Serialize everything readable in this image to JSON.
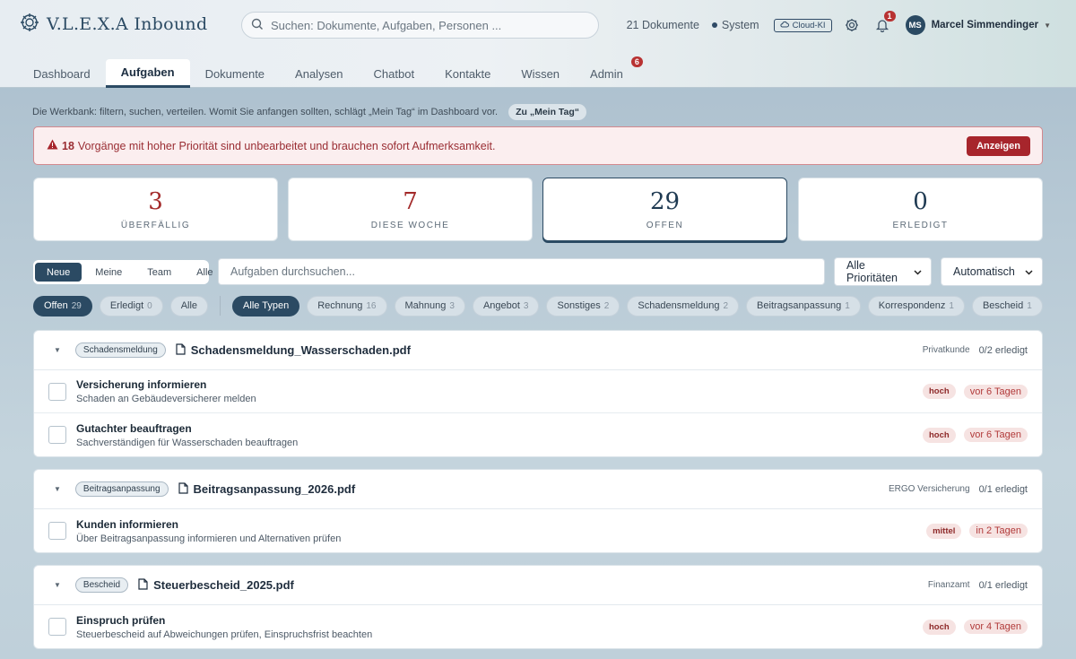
{
  "app": {
    "title": "V.L.E.X.A Inbound"
  },
  "search": {
    "placeholder": "Suchen: Dokumente, Aufgaben, Personen ..."
  },
  "status": {
    "doc_count": "21 Dokumente",
    "system": "System",
    "cloud": "Cloud-KI",
    "notif_count": "1"
  },
  "user": {
    "initials": "MS",
    "name": "Marcel Simmendinger"
  },
  "nav": {
    "tabs": [
      {
        "label": "Dashboard"
      },
      {
        "label": "Aufgaben"
      },
      {
        "label": "Dokumente"
      },
      {
        "label": "Analysen"
      },
      {
        "label": "Chatbot"
      },
      {
        "label": "Kontakte"
      },
      {
        "label": "Wissen"
      },
      {
        "label": "Admin",
        "badge": "6"
      }
    ]
  },
  "intro": {
    "text": "Die Werkbank: filtern, suchen, verteilen. Womit Sie anfangen sollten, schlägt „Mein Tag“ im Dashboard vor.",
    "link": "Zu „Mein Tag“"
  },
  "alert": {
    "count": "18",
    "text": "Vorgänge mit hoher Priorität sind unbearbeitet und brauchen sofort Aufmerksamkeit.",
    "button": "Anzeigen"
  },
  "stats": [
    {
      "value": "3",
      "label": "Überfällig",
      "color": "#a32a2a"
    },
    {
      "value": "7",
      "label": "Diese Woche",
      "color": "#a32a2a"
    },
    {
      "value": "29",
      "label": "Offen",
      "color": "#1f3a52"
    },
    {
      "value": "0",
      "label": "Erledigt",
      "color": "#1f3a52"
    }
  ],
  "filters": {
    "scope": [
      "Neue",
      "Meine",
      "Team",
      "Alle"
    ],
    "task_search_placeholder": "Aufgaben durchsuchen...",
    "priority_select": "Alle Prioritäten",
    "sort_select": "Automatisch",
    "status_pills": [
      {
        "label": "Offen",
        "count": "29"
      },
      {
        "label": "Erledigt",
        "count": "0"
      },
      {
        "label": "Alle",
        "count": ""
      }
    ],
    "type_pills": [
      {
        "label": "Alle Typen",
        "count": ""
      },
      {
        "label": "Rechnung",
        "count": "16"
      },
      {
        "label": "Mahnung",
        "count": "3"
      },
      {
        "label": "Angebot",
        "count": "3"
      },
      {
        "label": "Sonstiges",
        "count": "2"
      },
      {
        "label": "Schadensmeldung",
        "count": "2"
      },
      {
        "label": "Beitragsanpassung",
        "count": "1"
      },
      {
        "label": "Korrespondenz",
        "count": "1"
      },
      {
        "label": "Bescheid",
        "count": "1"
      }
    ]
  },
  "groups": [
    {
      "tag": "Schadensmeldung",
      "file": "Schadensmeldung_Wasserschaden.pdf",
      "party": "Privatkunde",
      "done": "0/2 erledigt",
      "tasks": [
        {
          "title": "Versicherung informieren",
          "sub": "Schaden an Gebäudeversicherer melden",
          "prio": "hoch",
          "due": "vor 6 Tagen"
        },
        {
          "title": "Gutachter beauftragen",
          "sub": "Sachverständigen für Wasserschaden beauftragen",
          "prio": "hoch",
          "due": "vor 6 Tagen"
        }
      ]
    },
    {
      "tag": "Beitragsanpassung",
      "file": "Beitragsanpassung_2026.pdf",
      "party": "ERGO Versicherung",
      "done": "0/1 erledigt",
      "tasks": [
        {
          "title": "Kunden informieren",
          "sub": "Über Beitragsanpassung informieren und Alternativen prüfen",
          "prio": "mittel",
          "due": "in 2 Tagen"
        }
      ]
    },
    {
      "tag": "Bescheid",
      "file": "Steuerbescheid_2025.pdf",
      "party": "Finanzamt",
      "done": "0/1 erledigt",
      "tasks": [
        {
          "title": "Einspruch prüfen",
          "sub": "Steuerbescheid auf Abweichungen prüfen, Einspruchsfrist beachten",
          "prio": "hoch",
          "due": "vor 4 Tagen"
        }
      ]
    }
  ]
}
